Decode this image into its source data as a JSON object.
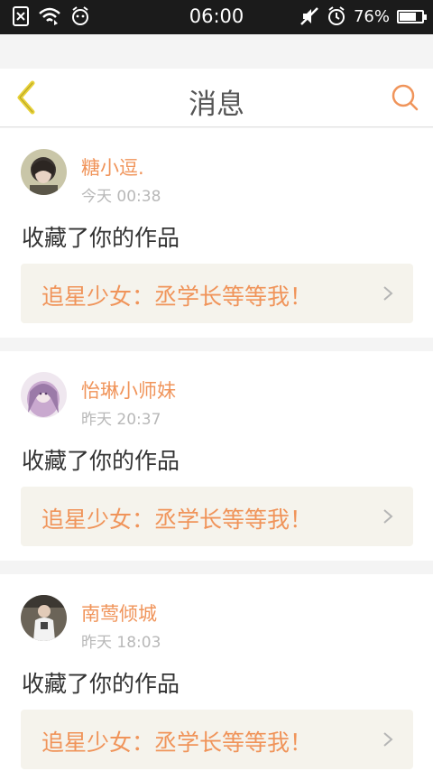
{
  "status_bar": {
    "time": "06:00",
    "battery_percent": "76%",
    "battery_level": 0.76,
    "icons_left": [
      "sim-off-icon",
      "wifi-icon",
      "alarm-face-icon"
    ],
    "icons_right": [
      "mute-icon",
      "alarm-icon",
      "battery-icon"
    ]
  },
  "header": {
    "title": "消息",
    "back_icon": "chevron-left-icon",
    "search_icon": "search-icon"
  },
  "colors": {
    "accent": "#f0945a",
    "back": "#e8d23a",
    "card_bg": "#f5f3ec"
  },
  "messages": [
    {
      "user": "糖小逗.",
      "time": "今天 00:38",
      "action": "收藏了你的作品",
      "work_title": "追星少女：丞学长等等我！"
    },
    {
      "user": "怡琳小师妹",
      "time": "昨天 20:37",
      "action": "收藏了你的作品",
      "work_title": "追星少女：丞学长等等我！"
    },
    {
      "user": "南莺倾城",
      "time": "昨天 18:03",
      "action": "收藏了你的作品",
      "work_title": "追星少女：丞学长等等我！"
    }
  ]
}
